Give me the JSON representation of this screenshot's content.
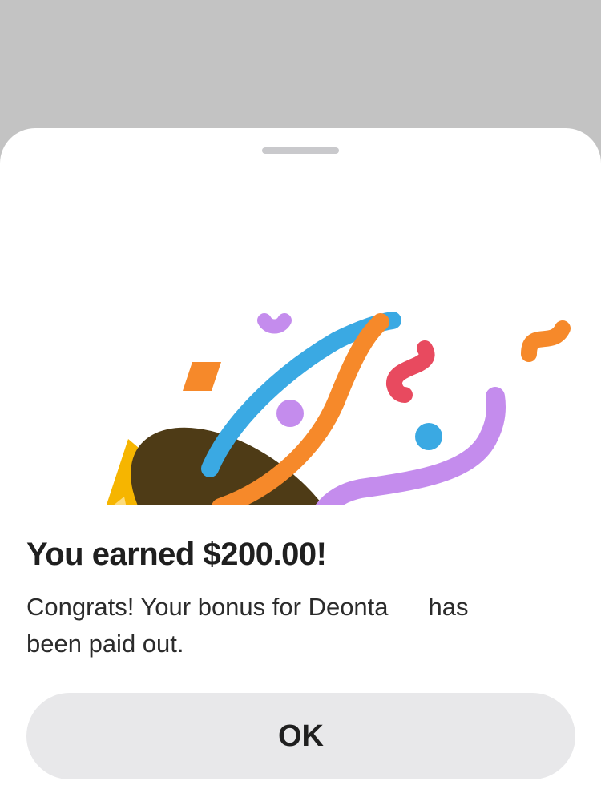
{
  "dialog": {
    "title": "You earned $200.00!",
    "message_part1": "Congrats! Your bonus for Deonta",
    "message_part2": "has",
    "message_part3": "been paid out.",
    "ok_label": "OK"
  },
  "illustration": {
    "icon": "party-popper-icon",
    "colors": {
      "cone_yellow": "#f6b500",
      "cone_stripe": "#fddc7c",
      "cone_mouth": "#4e3b16",
      "streamer_blue": "#3aa9e3",
      "streamer_orange": "#f6892a",
      "streamer_purple": "#c48ced",
      "confetti_red": "#e84a5f"
    }
  },
  "theme": {
    "backdrop": "#c3c3c3",
    "sheet": "#ffffff",
    "button_bg": "#e8e8ea",
    "text": "#1f1f1f"
  }
}
